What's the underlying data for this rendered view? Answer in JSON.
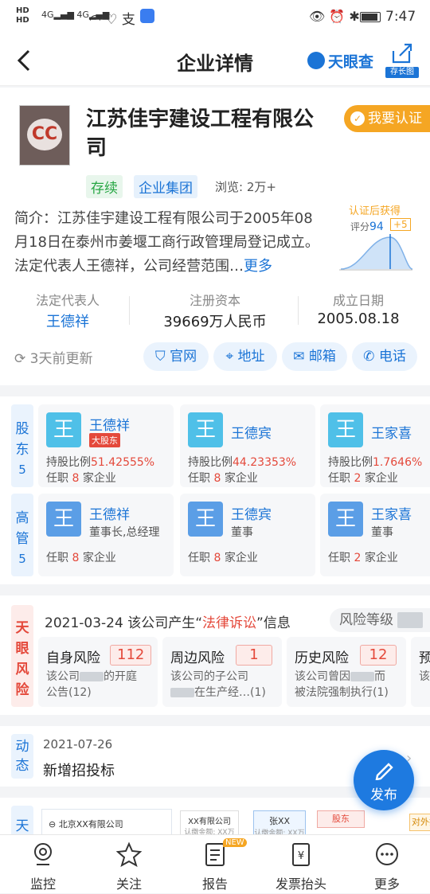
{
  "status_bar": {
    "time": "7:47",
    "network": "4G"
  },
  "nav": {
    "title": "企业详情",
    "brand": "天眼查",
    "long_image_label": "存长图"
  },
  "company": {
    "logo_text": "CC",
    "name": "江苏佳宇建设工程有限公司",
    "certify_button": "我要认证",
    "status_tag": "存续",
    "group_tag": "企业集团",
    "views_label": "浏览: 2万+",
    "intro": "简介：江苏佳宇建设工程有限公司于2005年08月18日在泰州市姜堰工商行政管理局登记成立。法定代表人王德祥，公司经营范围…",
    "more_link": "更多",
    "cert_badge_title": "认证后获得",
    "cert_score_label": "评分",
    "cert_score_value": "94",
    "cert_score_plus": "+5",
    "legal_rep_label": "法定代表人",
    "legal_rep_value": "王德祥",
    "capital_label": "注册资本",
    "capital_value": "39669万人民币",
    "founded_label": "成立日期",
    "founded_value": "2005.08.18",
    "updated_text": "3天前更新",
    "contacts": [
      "官网",
      "地址",
      "邮箱",
      "电话"
    ]
  },
  "shareholders": {
    "label": "股东",
    "count": "5",
    "items": [
      {
        "avatar": "王",
        "name": "王德祥",
        "badge": "大股东",
        "ratio_label": "持股比例",
        "ratio": "51.42555%",
        "jobs_prefix": "任职",
        "jobs": "8",
        "jobs_suffix": "家企业"
      },
      {
        "avatar": "王",
        "name": "王德宾",
        "badge": "",
        "ratio_label": "持股比例",
        "ratio": "44.23353%",
        "jobs_prefix": "任职",
        "jobs": "8",
        "jobs_suffix": "家企业"
      },
      {
        "avatar": "王",
        "name": "王家喜",
        "badge": "",
        "ratio_label": "持股比例",
        "ratio": "1.7646%",
        "jobs_prefix": "任职",
        "jobs": "2",
        "jobs_suffix": "家企业"
      }
    ]
  },
  "executives": {
    "label": "高管",
    "count": "5",
    "items": [
      {
        "avatar": "王",
        "name": "王德祥",
        "title": "董事长,总经理",
        "jobs_prefix": "任职",
        "jobs": "8",
        "jobs_suffix": "家企业"
      },
      {
        "avatar": "王",
        "name": "王德宾",
        "title": "董事",
        "jobs_prefix": "任职",
        "jobs": "8",
        "jobs_suffix": "家企业"
      },
      {
        "avatar": "王",
        "name": "王家喜",
        "title": "董事",
        "jobs_prefix": "任职",
        "jobs": "2",
        "jobs_suffix": "家企业"
      }
    ]
  },
  "risk": {
    "label": "天眼风险",
    "headline_prefix": "2021-03-24 该公司产生“",
    "headline_highlight": "法律诉讼",
    "headline_suffix": "”信息",
    "level_label": "风险等级",
    "items": [
      {
        "title": "自身风险",
        "count": "112",
        "desc1_a": "该公司",
        "desc1_b": "的开庭",
        "desc2": "公告(12)"
      },
      {
        "title": "周边风险",
        "count": "1",
        "desc1_a": "该公司的子公司",
        "desc1_b": "",
        "desc2_b": "在生产经…(1)"
      },
      {
        "title": "历史风险",
        "count": "12",
        "desc1_a": "该公司曾因",
        "desc1_b": "而",
        "desc2": "被法院强制执行(1)"
      },
      {
        "title": "预",
        "count": "",
        "desc1_a": "该公",
        "desc1_b": "",
        "desc2": ""
      }
    ]
  },
  "dynamics": {
    "label": "动态",
    "date": "2021-07-26",
    "text": "新增招投标"
  },
  "fab": {
    "label": "发布"
  },
  "graph_peek": {
    "label": "天",
    "company_a": "北京XX有限公司",
    "company_b": "XX有限公司",
    "amount_label": "认缴金额: XX万",
    "person": "张XX",
    "tag_shareholder": "股东",
    "tag_invest": "对外投"
  },
  "tabbar": {
    "items": [
      {
        "label": "监控",
        "icon": "monitor-icon"
      },
      {
        "label": "关注",
        "icon": "star-icon"
      },
      {
        "label": "报告",
        "icon": "report-icon",
        "badge": "NEW"
      },
      {
        "label": "发票抬头",
        "icon": "invoice-icon"
      },
      {
        "label": "更多",
        "icon": "more-icon"
      }
    ]
  },
  "colors": {
    "brand_blue": "#1b74d6",
    "risk_red": "#e4493b",
    "certify_orange": "#f5a623",
    "tag_green": "#e8f6ec"
  }
}
